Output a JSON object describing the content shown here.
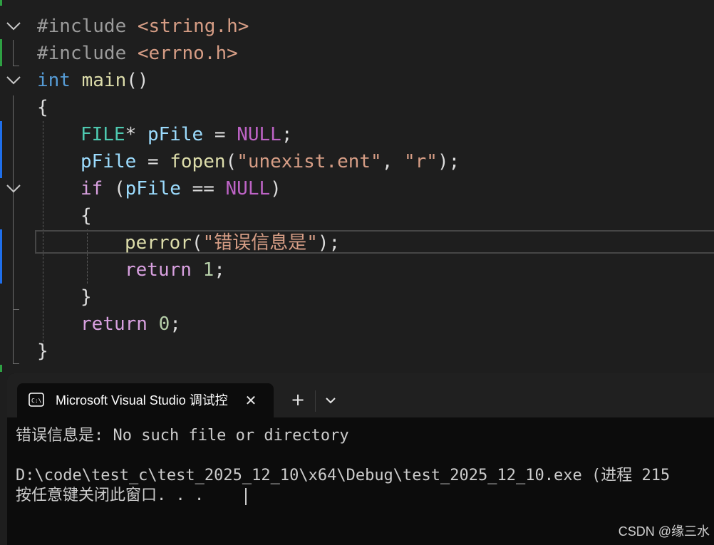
{
  "editor": {
    "tokens": {
      "l1_directive": "#include",
      "l1_header": "<string.h>",
      "l2_directive": "#include",
      "l2_header": "<errno.h>",
      "l3_kw": "int",
      "l3_fn": "main",
      "l3_parens": "()",
      "l4_brace": "{",
      "l5_type": "FILE",
      "l5_star": "*",
      "l5_var": "pFile",
      "l5_eq": "=",
      "l5_macro": "NULL",
      "l5_semi": ";",
      "l6_var": "pFile",
      "l6_eq": "=",
      "l6_fn": "fopen",
      "l6_open": "(",
      "l6_str1": "\"unexist.ent\"",
      "l6_comma": ",",
      "l6_str2": "\"r\"",
      "l6_close": ");",
      "l7_kw": "if",
      "l7_open": "(",
      "l7_var": "pFile",
      "l7_op": "==",
      "l7_macro": "NULL",
      "l7_close": ")",
      "l8_brace": "{",
      "l9_fn": "perror",
      "l9_open": "(",
      "l9_str": "\"错误信息是\"",
      "l9_close": ");",
      "l10_kw": "return",
      "l10_num": "1",
      "l10_semi": ";",
      "l11_brace": "}",
      "l12_kw": "return",
      "l12_num": "0",
      "l12_semi": ";",
      "l13_brace": "}"
    }
  },
  "terminal": {
    "tab_title": "Microsoft Visual Studio 调试控",
    "tab_icon": "console-icon",
    "close_icon": "close-icon",
    "new_tab_label": "+",
    "dropdown_icon": "chevron-down-icon",
    "output_line1": "错误信息是: No such file or directory",
    "output_line2": "D:\\code\\test_c\\test_2025_12_10\\x64\\Debug\\test_2025_12_10.exe (进程 215",
    "output_line3": "按任意键关闭此窗口. . ."
  },
  "watermark": "CSDN @缘三水",
  "colors": {
    "editor_bg": "#1e1e1e",
    "keyword": "#569cd6",
    "control": "#d8a0df",
    "string": "#d69d85",
    "function": "#dcdcaa",
    "type": "#4ec9b0",
    "variable": "#9cdcfe",
    "macro": "#bd63c5",
    "number": "#b5cea8",
    "change_saved": "#2ea043",
    "change_unsaved": "#1f6feb",
    "terminal_bg": "#0c0c0c"
  }
}
